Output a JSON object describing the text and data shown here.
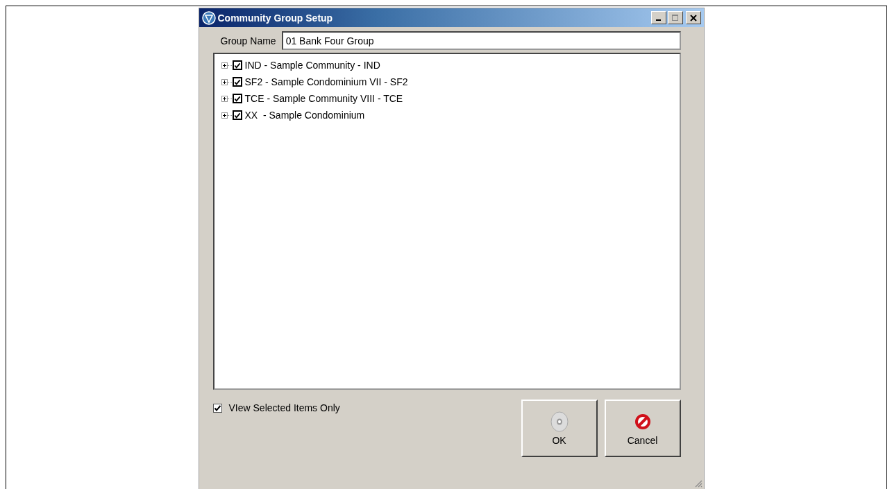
{
  "window": {
    "title": "Community Group Setup"
  },
  "group_name": {
    "label": "Group Name",
    "value": "01 Bank Four Group"
  },
  "tree": {
    "items": [
      {
        "label": "IND - Sample Community - IND",
        "checked": true,
        "expanded": false
      },
      {
        "label": "SF2 - Sample Condominium VII - SF2",
        "checked": true,
        "expanded": false
      },
      {
        "label": "TCE - Sample Community VIII - TCE",
        "checked": true,
        "expanded": false
      },
      {
        "label": "XX  - Sample Condominium",
        "checked": true,
        "expanded": false
      }
    ]
  },
  "view_selected_only": {
    "label": "VIew Selected Items Only",
    "checked": true
  },
  "buttons": [
    {
      "label": "OK",
      "kind": "ok"
    },
    {
      "label": "Cancel",
      "kind": "cancel"
    }
  ]
}
